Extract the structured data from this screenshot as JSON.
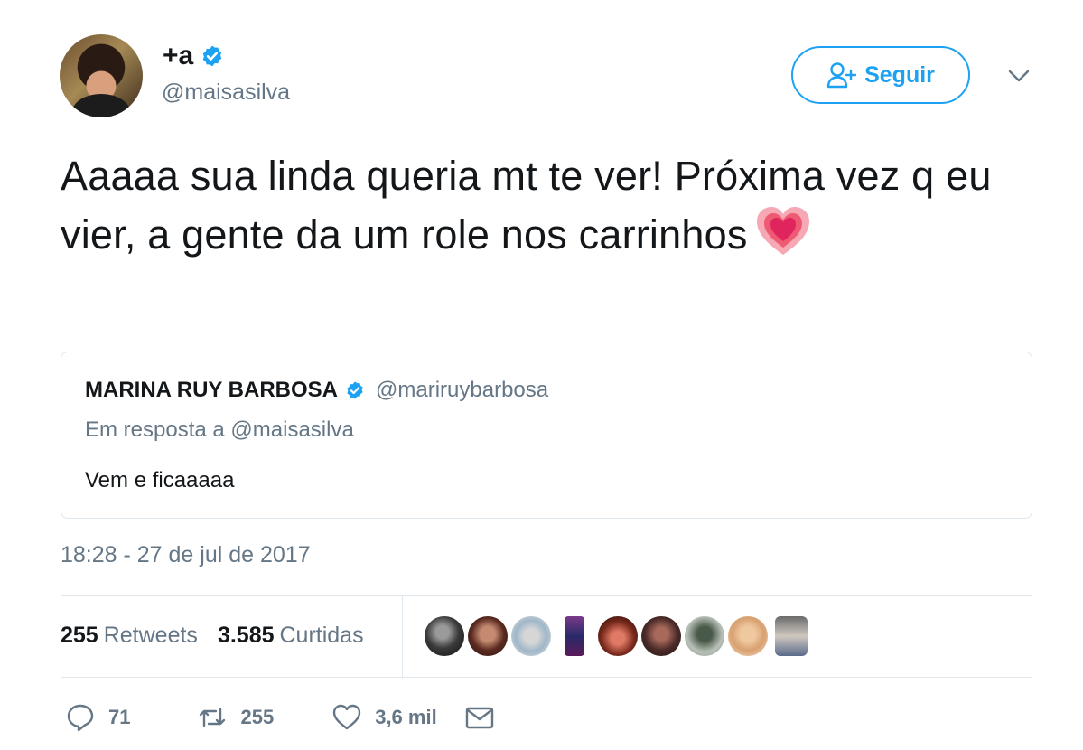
{
  "header": {
    "display_name": "+a",
    "username": "@maisasilva",
    "follow_label": "Seguir"
  },
  "tweet": {
    "text": "Aaaaa sua linda queria mt te ver! Próxima vez q eu vier, a gente da um role nos carrinhos",
    "emoji": "growing-heart-emoji"
  },
  "quote": {
    "name": "MARINA RUY BARBOSA",
    "username": "@mariruybarbosa",
    "reply_to": "Em resposta a @maisasilva",
    "text": "Vem e ficaaaaa"
  },
  "timestamp": "18:28 - 27 de jul de 2017",
  "stats": {
    "retweets_count": "255",
    "retweets_label": "Retweets",
    "likes_count": "3.585",
    "likes_label": "Curtidas"
  },
  "actions": {
    "reply_count": "71",
    "retweet_count": "255",
    "like_count": "3,6 mil"
  },
  "colors": {
    "brand": "#1da1f2",
    "text": "#14171a",
    "muted": "#657786",
    "border": "#e1e8ed",
    "heart": "#e0245e"
  },
  "icons": [
    "verified-icon",
    "add-user-icon",
    "chevron-down-icon",
    "reply-icon",
    "retweet-icon",
    "heart-icon",
    "envelope-icon"
  ]
}
